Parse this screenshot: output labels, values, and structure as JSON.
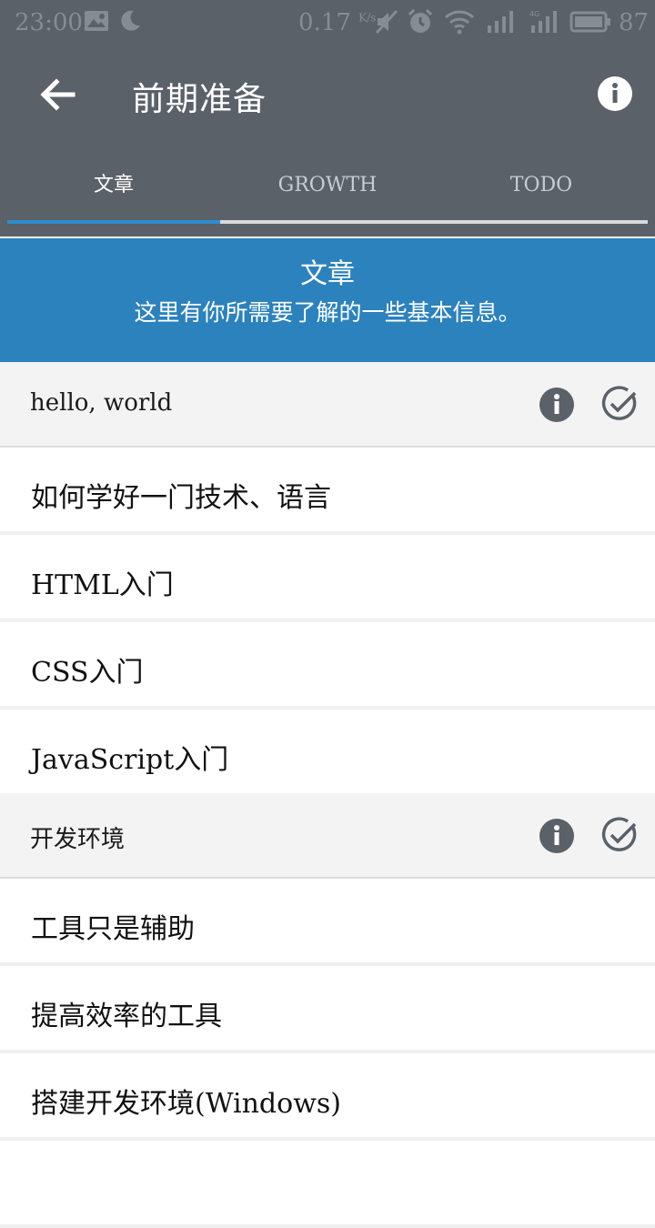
{
  "status_bar": {
    "time": "23:00",
    "speed": "0.17",
    "speed_unit": "K/s",
    "battery": "87",
    "icons": [
      "image-icon",
      "moon-icon",
      "mute-icon",
      "alarm-icon",
      "wifi-icon",
      "signal-icon",
      "signal-4g-icon",
      "battery-icon"
    ]
  },
  "app_bar": {
    "title": "前期准备",
    "back_icon": "arrow-left-icon",
    "info_icon": "info-icon"
  },
  "tabs": [
    {
      "label": "文章",
      "active": true
    },
    {
      "label": "GROWTH",
      "active": false
    },
    {
      "label": "TODO",
      "active": false
    }
  ],
  "banner": {
    "title": "文章",
    "subtitle": "这里有你所需要了解的一些基本信息。"
  },
  "sections": [
    {
      "title": "hello, world",
      "items": [
        "如何学好一门技术、语言",
        "HTML入门",
        "CSS入门",
        "JavaScript入门"
      ]
    },
    {
      "title": "开发环境",
      "items": [
        "工具只是辅助",
        "提高效率的工具",
        "搭建开发环境(Windows)"
      ]
    }
  ],
  "colors": {
    "toolbar": "#5a6169",
    "accent": "#2c8ecf",
    "banner": "#2b82bd"
  }
}
